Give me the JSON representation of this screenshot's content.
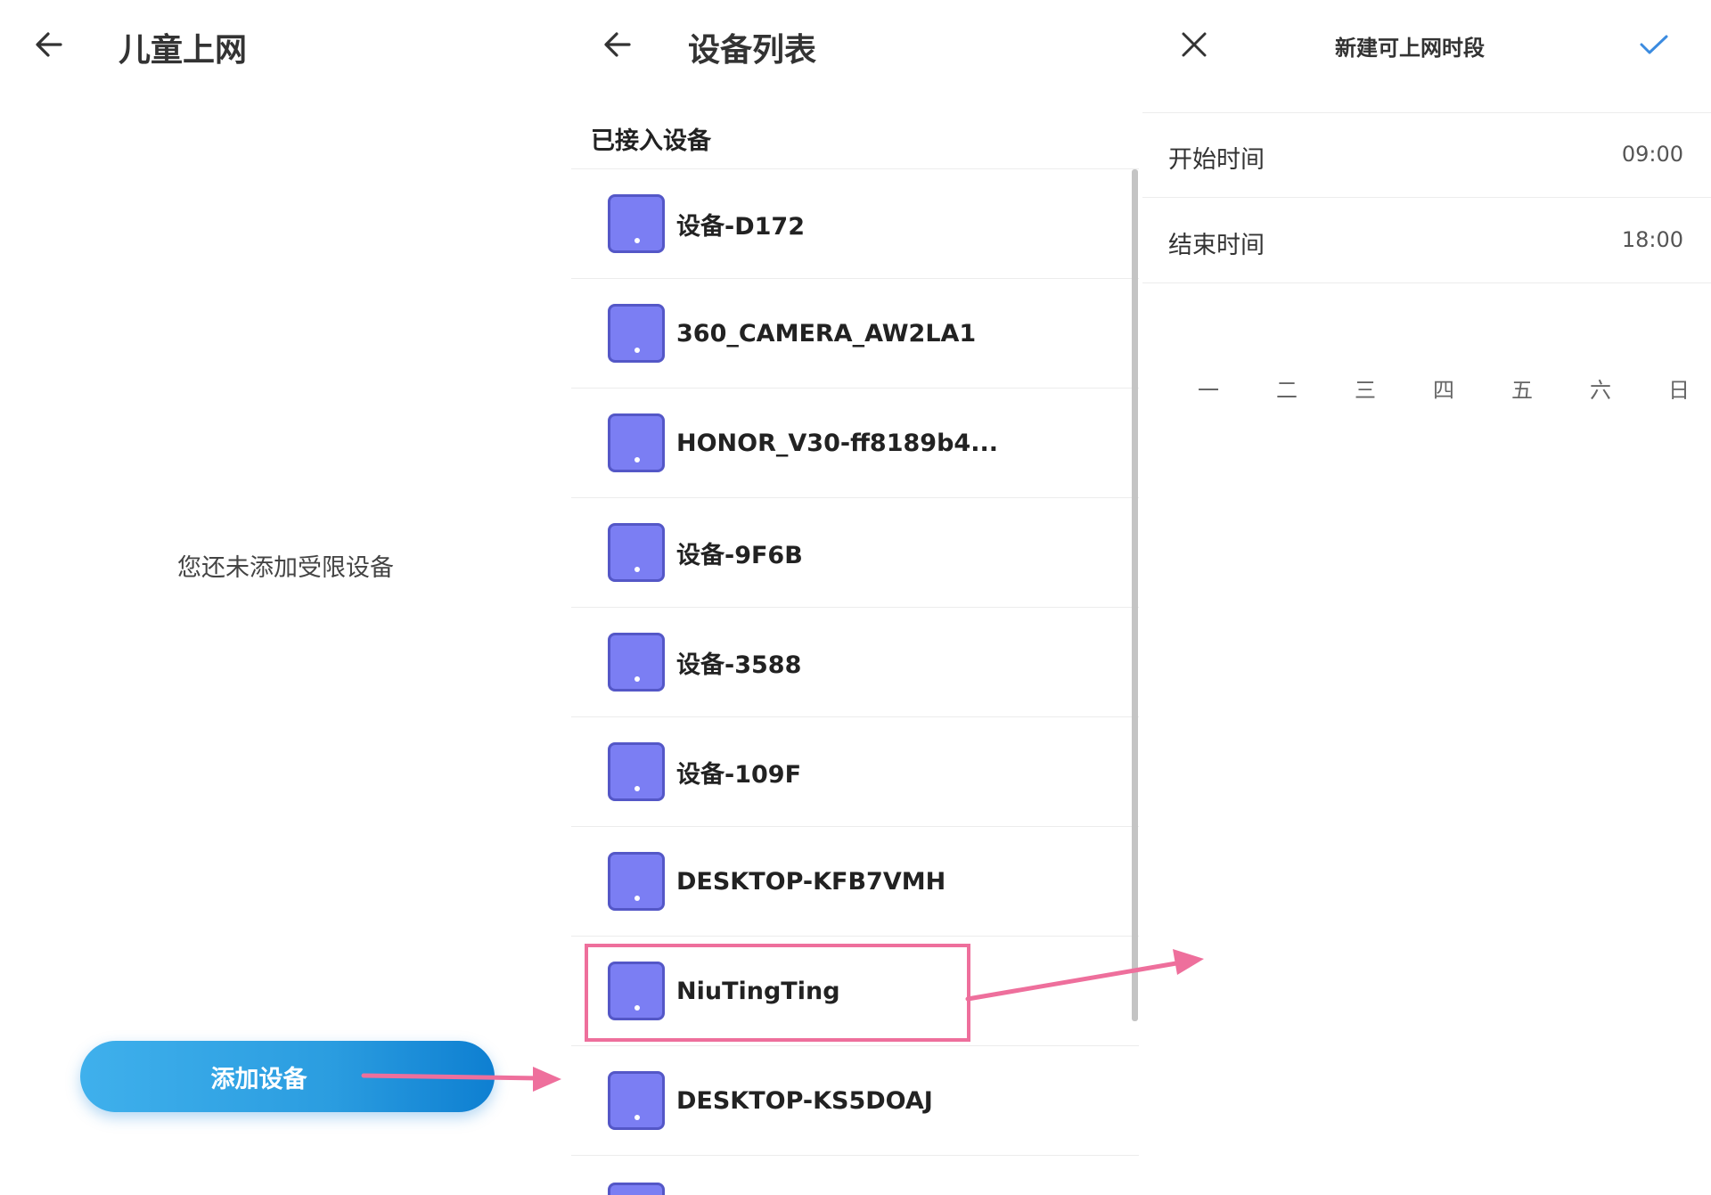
{
  "left_panel": {
    "title": "儿童上网",
    "empty_message": "您还未添加受限设备",
    "add_button_label": "添加设备"
  },
  "middle_panel": {
    "title": "设备列表",
    "section_header": "已接入设备",
    "devices": [
      {
        "name": "设备-D172"
      },
      {
        "name": "360_CAMERA_AW2LA1"
      },
      {
        "name": "HONOR_V30-ff8189b4..."
      },
      {
        "name": "设备-9F6B"
      },
      {
        "name": "设备-3588"
      },
      {
        "name": "设备-109F"
      },
      {
        "name": "DESKTOP-KFB7VMH"
      },
      {
        "name": "NiuTingTing"
      },
      {
        "name": "DESKTOP-KS5DOAJ"
      }
    ],
    "highlighted_device": "NiuTingTing"
  },
  "right_panel": {
    "title": "新建可上网时段",
    "start_label": "开始时间",
    "start_value": "09:00",
    "end_label": "结束时间",
    "end_value": "18:00",
    "weekdays": [
      "一",
      "二",
      "三",
      "四",
      "五",
      "六",
      "日"
    ]
  },
  "colors": {
    "accent_blue": "#2b9de0",
    "device_icon": "#7b7ef3",
    "highlight": "#ee6f9c",
    "confirm_check": "#3b8be0"
  },
  "icons": {
    "back": "arrow-left-icon",
    "close": "close-icon",
    "confirm": "checkmark-icon",
    "device": "device-icon"
  }
}
